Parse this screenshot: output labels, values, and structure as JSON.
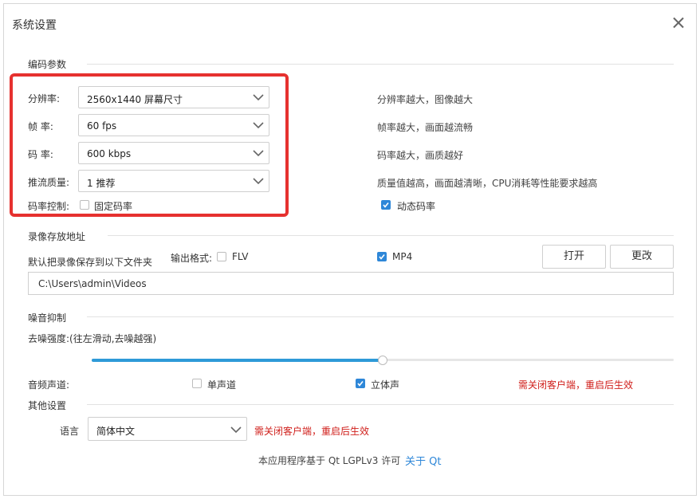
{
  "dialog": {
    "title": "系统设置"
  },
  "encoding": {
    "section_title": "编码参数",
    "resolution": {
      "label": "分辨率:",
      "value": "2560x1440 屏幕尺寸",
      "hint": "分辨率越大，图像越大"
    },
    "framerate": {
      "label": "帧  率:",
      "value": "60 fps",
      "hint": "帧率越大，画面越流畅"
    },
    "bitrate": {
      "label": "码  率:",
      "value": "600 kbps",
      "hint": "码率越大，画质越好"
    },
    "quality": {
      "label": "推流质量:",
      "value": "1 推荐",
      "hint": "质量值越高，画面越清晰，CPU消耗等性能要求越高"
    },
    "rate_control": {
      "label": "码率控制:",
      "fixed_label": "固定码率",
      "fixed_checked": false,
      "dynamic_label": "动态码率",
      "dynamic_checked": true
    }
  },
  "recording": {
    "section_title": "录像存放地址",
    "desc": "默认把录像保存到以下文件夹",
    "format_label": "输出格式:",
    "flv_label": "FLV",
    "flv_checked": false,
    "mp4_label": "MP4",
    "mp4_checked": true,
    "open_button": "打开",
    "change_button": "更改",
    "path": "C:\\Users\\admin\\Videos"
  },
  "noise": {
    "section_title": "噪音抑制",
    "strength_label": "去噪强度:(往左滑动,去噪越强)",
    "slider_value": 0.5,
    "channel_label": "音频声道:",
    "mono_label": "单声道",
    "mono_checked": false,
    "stereo_label": "立体声",
    "stereo_checked": true,
    "restart_note": "需关闭客户端，重启后生效"
  },
  "other": {
    "section_title": "其他设置",
    "language_label": "语言",
    "language_value": "简体中文",
    "restart_note": "需关闭客户端，重启后生效"
  },
  "footer": {
    "text": "本应用程序基于 Qt LGPLv3 许可",
    "link": "关于 Qt"
  },
  "colors": {
    "accent": "#2e87d8",
    "highlight_border": "#e6312f",
    "warning_text": "#d0201c"
  }
}
